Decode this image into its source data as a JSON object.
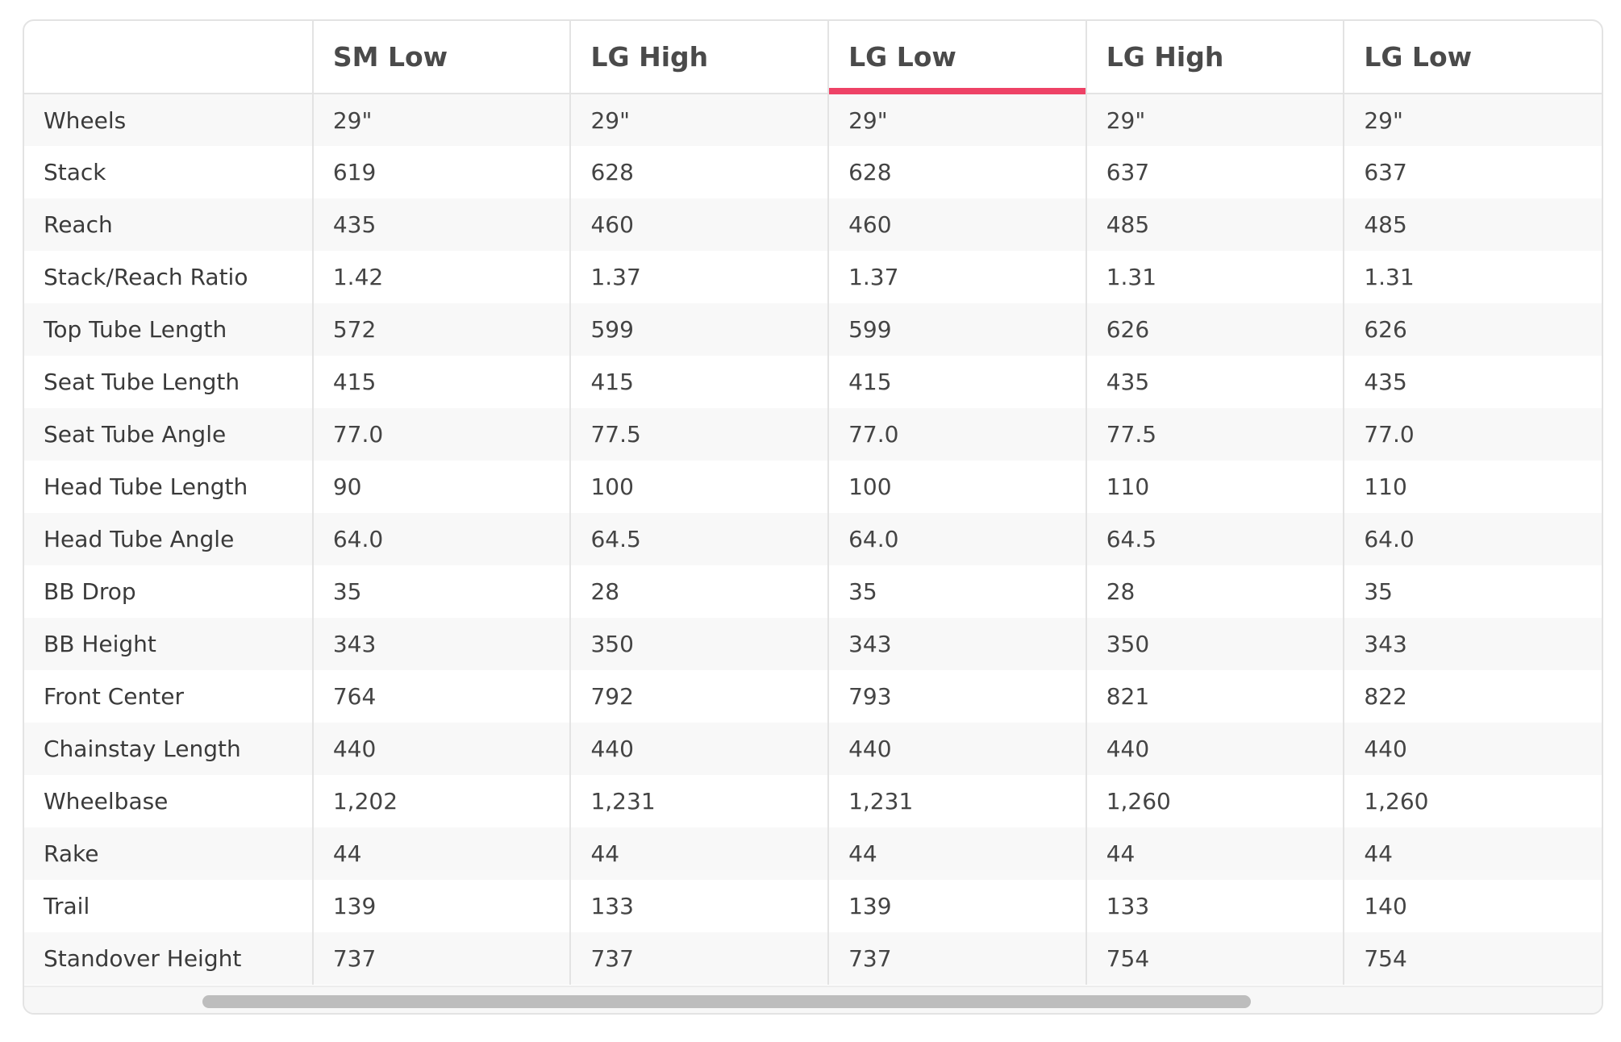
{
  "columns": [
    "",
    "SM Low",
    "LG High",
    "LG Low",
    "LG High",
    "LG Low"
  ],
  "active_column_index": 3,
  "accent_color": "#ee4266",
  "rows": [
    {
      "label": "Wheels",
      "values": [
        "29\"",
        "29\"",
        "29\"",
        "29\"",
        "29\""
      ]
    },
    {
      "label": "Stack",
      "values": [
        "619",
        "628",
        "628",
        "637",
        "637"
      ]
    },
    {
      "label": "Reach",
      "values": [
        "435",
        "460",
        "460",
        "485",
        "485"
      ]
    },
    {
      "label": "Stack/Reach Ratio",
      "values": [
        "1.42",
        "1.37",
        "1.37",
        "1.31",
        "1.31"
      ]
    },
    {
      "label": "Top Tube Length",
      "values": [
        "572",
        "599",
        "599",
        "626",
        "626"
      ]
    },
    {
      "label": "Seat Tube Length",
      "values": [
        "415",
        "415",
        "415",
        "435",
        "435"
      ]
    },
    {
      "label": "Seat Tube Angle",
      "values": [
        "77.0",
        "77.5",
        "77.0",
        "77.5",
        "77.0"
      ]
    },
    {
      "label": "Head Tube Length",
      "values": [
        "90",
        "100",
        "100",
        "110",
        "110"
      ]
    },
    {
      "label": "Head Tube Angle",
      "values": [
        "64.0",
        "64.5",
        "64.0",
        "64.5",
        "64.0"
      ]
    },
    {
      "label": "BB Drop",
      "values": [
        "35",
        "28",
        "35",
        "28",
        "35"
      ]
    },
    {
      "label": "BB Height",
      "values": [
        "343",
        "350",
        "343",
        "350",
        "343"
      ]
    },
    {
      "label": "Front Center",
      "values": [
        "764",
        "792",
        "793",
        "821",
        "822"
      ]
    },
    {
      "label": "Chainstay Length",
      "values": [
        "440",
        "440",
        "440",
        "440",
        "440"
      ]
    },
    {
      "label": "Wheelbase",
      "values": [
        "1,202",
        "1,231",
        "1,231",
        "1,260",
        "1,260"
      ]
    },
    {
      "label": "Rake",
      "values": [
        "44",
        "44",
        "44",
        "44",
        "44"
      ]
    },
    {
      "label": "Trail",
      "values": [
        "139",
        "133",
        "139",
        "133",
        "140"
      ]
    },
    {
      "label": "Standover Height",
      "values": [
        "737",
        "737",
        "737",
        "754",
        "754"
      ]
    }
  ]
}
